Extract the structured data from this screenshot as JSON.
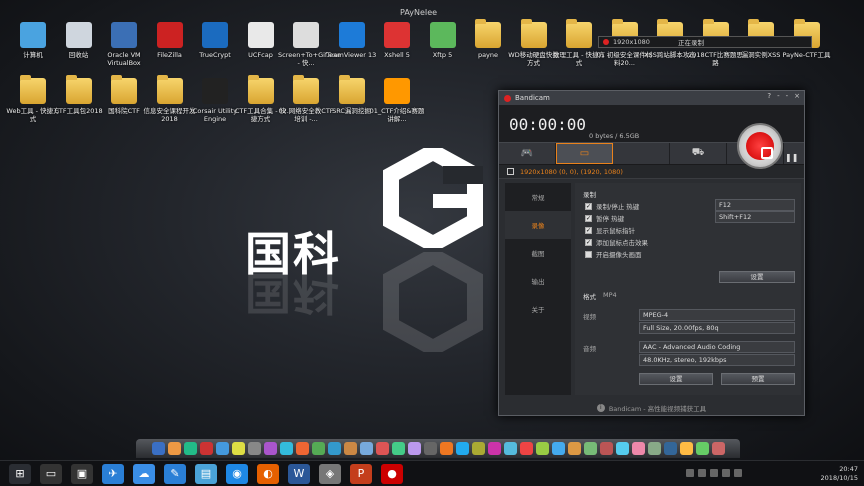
{
  "desktop": {
    "user_folder_label": "PAyNeIee",
    "icons_row1": [
      {
        "label": "计算机",
        "icon": "computer-icon"
      },
      {
        "label": "回收站",
        "icon": "recycle-bin-icon"
      },
      {
        "label": "Oracle VM VirtualBox",
        "icon": "virtualbox-icon"
      },
      {
        "label": "FileZilla",
        "icon": "filezilla-icon"
      },
      {
        "label": "TrueCrypt",
        "icon": "truecrypt-icon"
      },
      {
        "label": "UCFcap",
        "icon": "ucfcap-icon"
      },
      {
        "label": "Screen+To+Gif.exe - 快...",
        "icon": "screentogif-icon"
      },
      {
        "label": "TeamViewer 13",
        "icon": "teamviewer-icon"
      },
      {
        "label": "Xshell 5",
        "icon": "xshell-icon"
      },
      {
        "label": "Xftp 5",
        "icon": "xftp-icon"
      },
      {
        "label": "payne",
        "icon": "folder-icon"
      },
      {
        "label": "WD移动硬盘快捷方式",
        "icon": "folder-icon"
      },
      {
        "label": "数理工具 - 快捷方式",
        "icon": "folder-icon"
      },
      {
        "label": "01 初级安全课件材料20...",
        "icon": "folder-icon"
      },
      {
        "label": "XSS跨站脚本攻击",
        "icon": "folder-icon"
      },
      {
        "label": "2018CTF比赛题思路",
        "icon": "folder-icon"
      },
      {
        "label": "漏洞实例XSS",
        "icon": "folder-icon"
      },
      {
        "label": "PayNe-CTF工具",
        "icon": "folder-icon"
      }
    ],
    "icons_row2": [
      {
        "label": "Web工具 - 快捷方式",
        "icon": "folder-icon"
      },
      {
        "label": "CTF工具包2018",
        "icon": "folder-icon"
      },
      {
        "label": "国科院CTF",
        "icon": "folder-icon"
      },
      {
        "label": "信息安全课程开发2018",
        "icon": "folder-icon"
      },
      {
        "label": "Corsair Utility Engine",
        "icon": "corsair-icon"
      },
      {
        "label": "CTF工具合集 - 快捷方式",
        "icon": "folder-icon"
      },
      {
        "label": "02.网络安全教CTF培训 -...",
        "icon": "folder-icon"
      },
      {
        "label": "SRC漏洞挖掘",
        "icon": "folder-icon"
      },
      {
        "label": "01_CTF介绍&赛题讲解...",
        "icon": "doc-icon"
      }
    ],
    "wallpaper_text": "国科"
  },
  "recording_bar": {
    "resolution": "1920x1080",
    "status": "正在录制"
  },
  "bandicam": {
    "title": "Bandicam",
    "time": "00:00:00",
    "size": "0 bytes / 6.5GB",
    "resolution_line": "1920x1080  (0, 0), (1920, 1080)",
    "tabs": [
      {
        "icon": "gamepad-icon",
        "glyph": "🎮"
      },
      {
        "icon": "screen-icon",
        "glyph": "▭"
      },
      {
        "icon": "blank-icon",
        "glyph": ""
      },
      {
        "icon": "device-icon",
        "glyph": "⛟"
      },
      {
        "icon": "camera-icon",
        "glyph": "📷"
      }
    ],
    "sidebar": [
      "常规",
      "录像",
      "截图",
      "输出",
      "关于"
    ],
    "section_record": "录制",
    "record_options": [
      {
        "label": "录制/停止 热键",
        "checked": true,
        "hotkey": "F12"
      },
      {
        "label": "暂停 热键",
        "checked": true,
        "hotkey": "Shift+F12"
      },
      {
        "label": "显示鼠标指针",
        "checked": true
      },
      {
        "label": "添加鼠标点击效果",
        "checked": true
      },
      {
        "label": "开启摄像头画面",
        "checked": false
      }
    ],
    "settings_button": "设置",
    "format_label": "格式",
    "format_value": "MP4",
    "video_label": "视频",
    "video_codec": "MPEG-4",
    "video_detail": "Full Size, 20.00fps, 80q",
    "audio_label": "音频",
    "audio_codec": "AAC - Advanced Audio Coding",
    "audio_detail": "48.0KHz, stereo, 192kbps",
    "format_settings_button": "设置",
    "preset_button": "预置",
    "footer": "Bandicam - 高性能视频捕获工具"
  },
  "taskbar": {
    "time": "20:47",
    "date": "2018/10/15",
    "apps": [
      {
        "icon": "start-icon",
        "color": "#2a2d33",
        "glyph": "⊞"
      },
      {
        "icon": "terminal-icon",
        "color": "#333",
        "glyph": "▭"
      },
      {
        "icon": "monitor-icon",
        "color": "#333",
        "glyph": "▣"
      },
      {
        "icon": "qq-icon",
        "color": "#2a7fd6",
        "glyph": "✈"
      },
      {
        "icon": "baidu-cloud-icon",
        "color": "#3a8ee6",
        "glyph": "☁"
      },
      {
        "icon": "pen-icon",
        "color": "#2a7fd6",
        "glyph": "✎"
      },
      {
        "icon": "file-icon",
        "color": "#4aa3d8",
        "glyph": "▤"
      },
      {
        "icon": "qq-browser-icon",
        "color": "#1e88e5",
        "glyph": "◉"
      },
      {
        "icon": "firefox-icon",
        "color": "#e66000",
        "glyph": "◐"
      },
      {
        "icon": "word-icon",
        "color": "#2b5797",
        "glyph": "W"
      },
      {
        "icon": "mixer-icon",
        "color": "#777",
        "glyph": "◈"
      },
      {
        "icon": "powerpoint-icon",
        "color": "#c43e1c",
        "glyph": "P"
      },
      {
        "icon": "bandicam-icon",
        "color": "#c00",
        "glyph": "●"
      }
    ]
  }
}
